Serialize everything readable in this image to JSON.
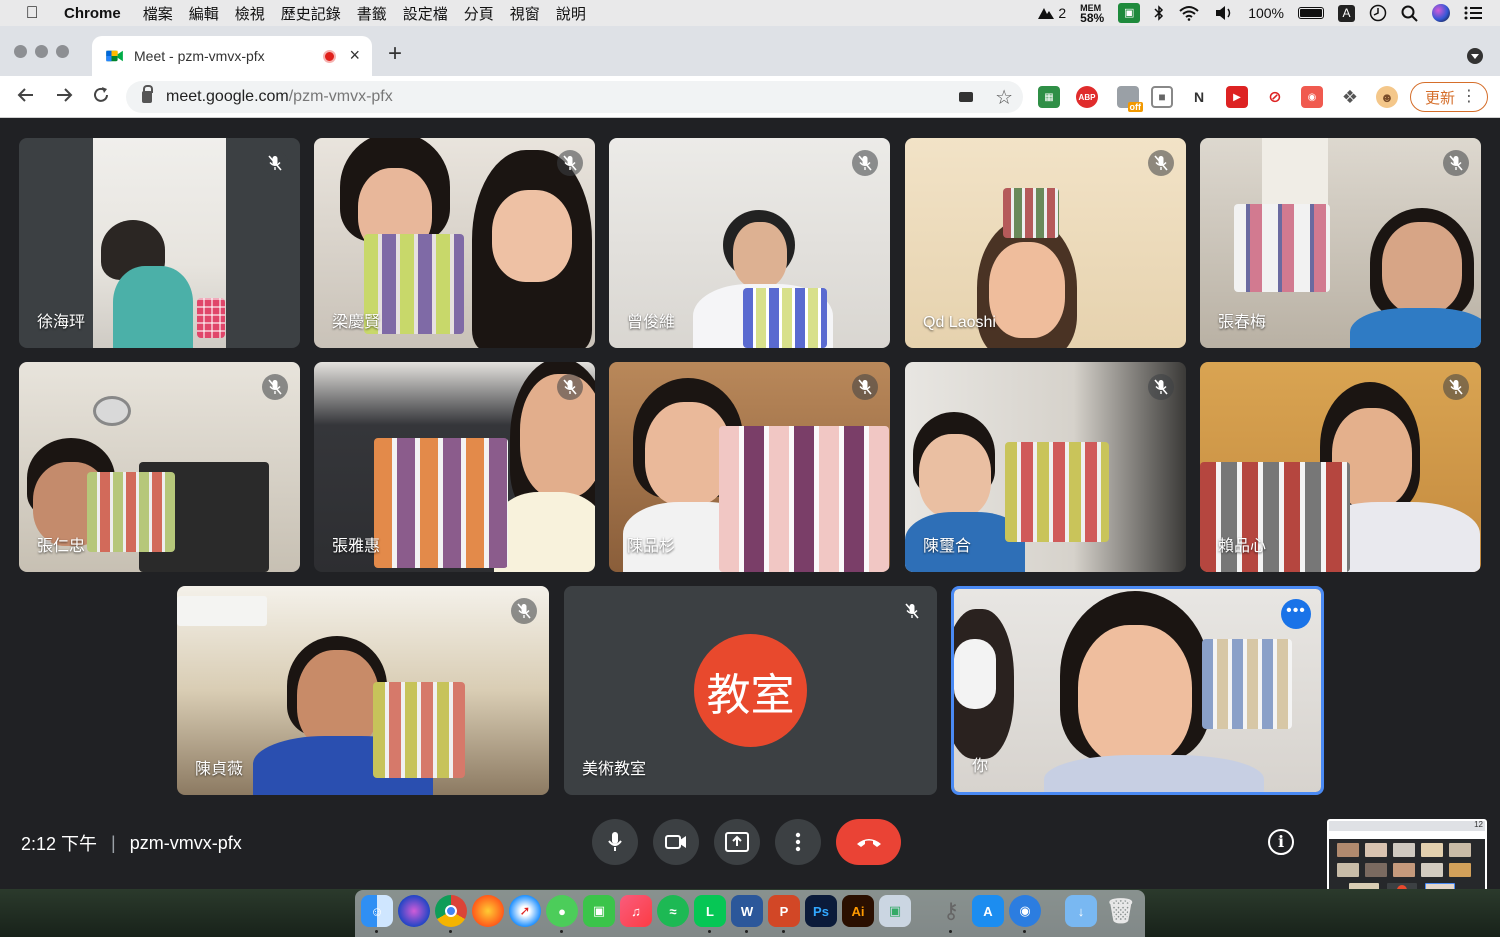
{
  "menubar": {
    "app_name": "Chrome",
    "items": [
      "檔案",
      "編輯",
      "檢視",
      "歷史記錄",
      "書籤",
      "設定檔",
      "分頁",
      "視窗",
      "說明"
    ],
    "status": {
      "app_count": "2",
      "mem_label": "MEM",
      "mem_value": "58%",
      "battery": "100%",
      "input_method": "A"
    }
  },
  "browser": {
    "tab_title": "Meet - pzm-vmvx-pfx",
    "url_host": "meet.google.com",
    "url_path": "/pzm-vmvx-pfx",
    "extension_labels": [
      "ABP",
      "off"
    ],
    "update_label": "更新"
  },
  "meet": {
    "participants": [
      {
        "name": "徐海玶",
        "muted": true
      },
      {
        "name": "梁慶賢",
        "muted": true
      },
      {
        "name": "曾俊維",
        "muted": true
      },
      {
        "name": "Qd Laoshi",
        "muted": true
      },
      {
        "name": "張春梅",
        "muted": true
      },
      {
        "name": "張仁忠",
        "muted": true
      },
      {
        "name": "張雅惠",
        "muted": true
      },
      {
        "name": "陳品杉",
        "muted": true
      },
      {
        "name": "陳璽合",
        "muted": true
      },
      {
        "name": "賴品心",
        "muted": true
      },
      {
        "name": "陳貞薇",
        "muted": true
      },
      {
        "name": "美術教室",
        "muted": true,
        "avatar_text": "教室"
      },
      {
        "name": "你",
        "muted": false
      }
    ],
    "time": "2:12 下午",
    "separator": "|",
    "meeting_code": "pzm-vmvx-pfx",
    "info_glyph": "i",
    "more_glyph": "•••",
    "minimap_badge": "12"
  },
  "colors": {
    "meet_bg": "#202124",
    "control_bg": "#3c4043",
    "end_call": "#ea4335",
    "avatar": "#e8492d",
    "active_speaker": "#4a8af4",
    "update_accent": "#d56e2a"
  }
}
